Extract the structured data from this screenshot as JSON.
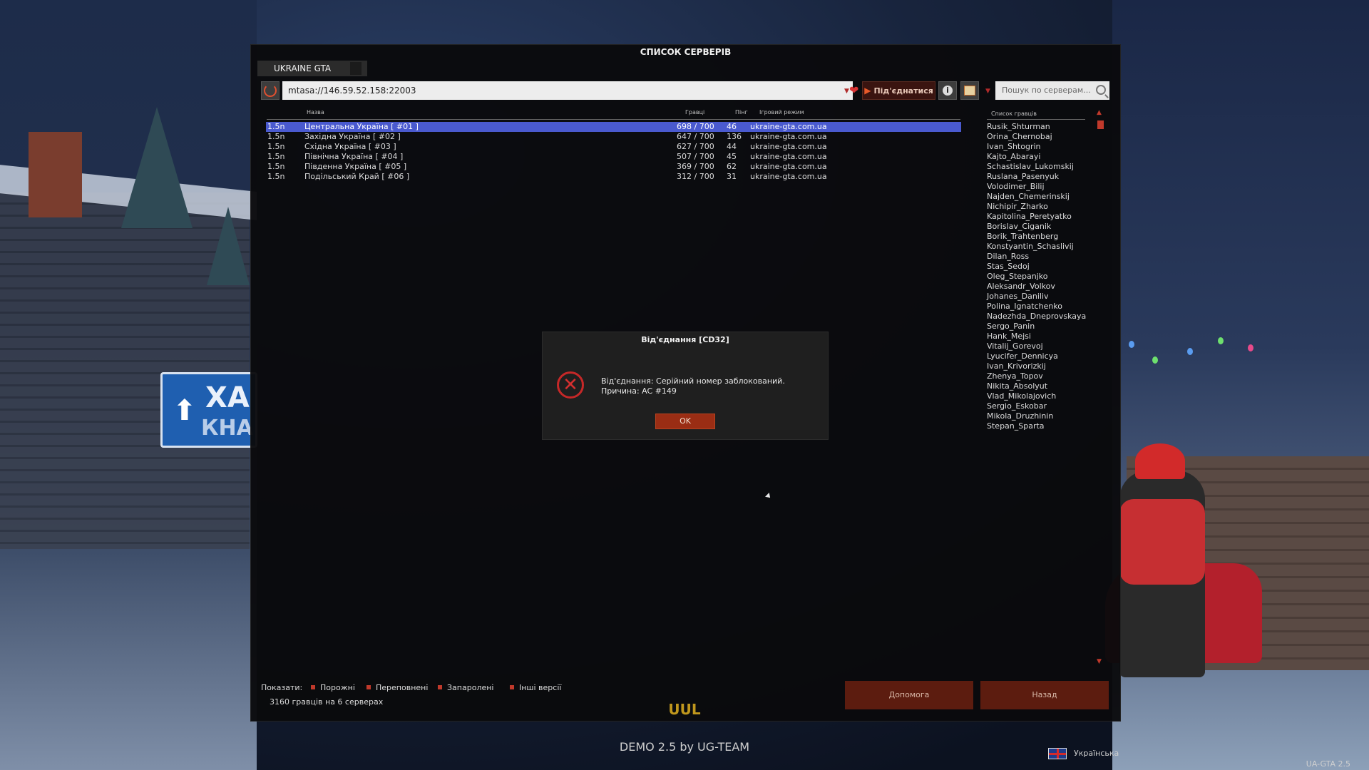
{
  "window": {
    "title": "СПИСОК СЕРВЕРІВ",
    "tab_label": "UKRAINE GTA"
  },
  "toolbar": {
    "address": "mtasa://146.59.52.158:22003",
    "connect_label": "Під'єднатися",
    "search_placeholder": "Пошук по серверам..."
  },
  "server_list": {
    "columns": {
      "name": "Назва",
      "players": "Гравці",
      "ping": "Пінг",
      "mode": "Ігровий режим"
    },
    "rows": [
      {
        "version": "1.5n",
        "name": "Центральна Україна [ #01 ]",
        "players": "698 / 700",
        "ping": "46",
        "mode": "ukraine-gta.com.ua"
      },
      {
        "version": "1.5n",
        "name": "Західна Україна [ #02 ]",
        "players": "647 / 700",
        "ping": "136",
        "mode": "ukraine-gta.com.ua"
      },
      {
        "version": "1.5n",
        "name": "Східна Україна [ #03 ]",
        "players": "627 / 700",
        "ping": "44",
        "mode": "ukraine-gta.com.ua"
      },
      {
        "version": "1.5n",
        "name": "Північна Україна [ #04 ]",
        "players": "507 / 700",
        "ping": "45",
        "mode": "ukraine-gta.com.ua"
      },
      {
        "version": "1.5n",
        "name": "Південна Україна [ #05 ]",
        "players": "369 / 700",
        "ping": "62",
        "mode": "ukraine-gta.com.ua"
      },
      {
        "version": "1.5n",
        "name": "Подільський Край [ #06 ]",
        "players": "312 / 700",
        "ping": "31",
        "mode": "ukraine-gta.com.ua"
      }
    ]
  },
  "players_panel": {
    "header": "Список гравців",
    "names": [
      "Rusik_Shturman",
      "Orina_Chernobaj",
      "Ivan_Shtogrin",
      "Kajto_Abarayi",
      "Schastislav_Lukomskij",
      "Ruslana_Pasenyuk",
      "Volodimer_Bilij",
      "Najden_Chemerinskij",
      "Nichipir_Zharko",
      "Kapitolina_Peretyatko",
      "Borislav_Ciganik",
      "Borik_Trahtenberg",
      "Konstyantin_Schaslivij",
      "Dilan_Ross",
      "Stas_Sedoj",
      "Oleg_Stepanjko",
      "Aleksandr_Volkov",
      "Johanes_Daniliv",
      "Polina_Ignatchenko",
      "Nadezhda_Dneprovskaya",
      "Sergo_Panin",
      "Hank_Mejsi",
      "Vitalij_Gorevoj",
      "Lyucifer_Dennicya",
      "Ivan_Krivorizkij",
      "Zhenya_Topov",
      "Nikita_Absolyut",
      "Vlad_Mikolajovich",
      "Sergio_Eskobar",
      "Mikola_Druzhinin",
      "Stepan_Sparta"
    ]
  },
  "filters": {
    "label": "Показати:",
    "empty": "Порожні",
    "full": "Переповнені",
    "locked": "Запаролені",
    "other_versions": "Інші версії",
    "summary": "3160 гравців на 6 серверах"
  },
  "buttons": {
    "help": "Допомога",
    "back": "Назад"
  },
  "dialog": {
    "title": "Від'єднання [CD32]",
    "line1": "Від'єднання: Серійний номер заблокований.",
    "line2": "Причина: AC #149",
    "ok": "OK"
  },
  "background": {
    "sign_line1": "ХА",
    "sign_line2": "КНА",
    "logo_text": "UUL"
  },
  "footer": {
    "demo": "DEMO 2.5 by UG-TEAM",
    "language": "Українська",
    "version": "UA-GTA 2.5"
  },
  "colors": {
    "accent": "#c0392b",
    "selection": "#4a5acf",
    "button": "#5c1c0f"
  }
}
